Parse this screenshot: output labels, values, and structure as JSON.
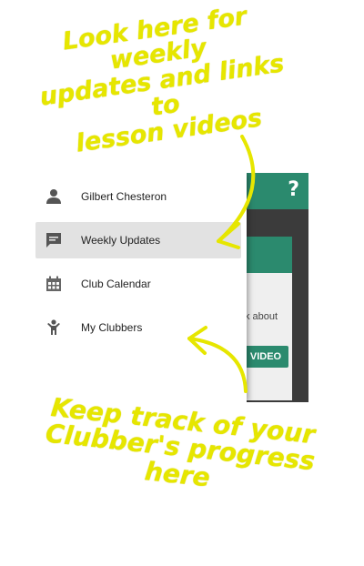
{
  "annotations": {
    "top_lines": [
      "Look here for weekly",
      "updates and links to",
      "lesson videos"
    ],
    "bottom_lines": [
      "Keep track of your",
      "Clubber's progress here"
    ]
  },
  "app": {
    "help_icon": "?",
    "partial_text": "k about",
    "video_button": "VIDEO",
    "accent_color": "#2b8a6e"
  },
  "drawer": {
    "user_name": "Gilbert Chesteron",
    "items": [
      {
        "label": "Weekly Updates",
        "icon": "message-icon",
        "active": true
      },
      {
        "label": "Club Calendar",
        "icon": "calendar-icon",
        "active": false
      },
      {
        "label": "My Clubbers",
        "icon": "child-icon",
        "active": false
      }
    ]
  }
}
